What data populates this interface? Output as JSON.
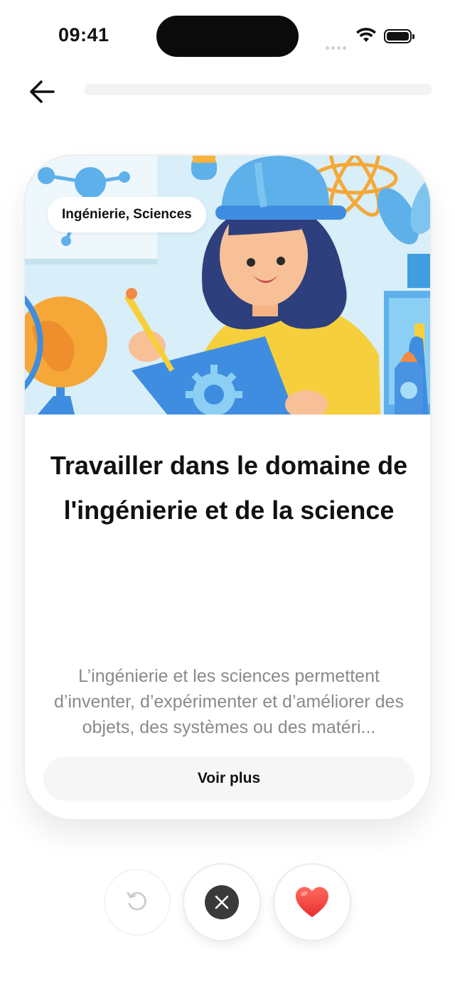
{
  "status_bar": {
    "time": "09:41"
  },
  "header": {
    "back_icon": "arrow-left-icon",
    "progress": 0.0
  },
  "card": {
    "tag": "Ingénierie, Sciences",
    "title": "Travailler dans le domaine de l'ingénierie et de la science",
    "description": "L’ingénierie et les sciences permettent d’inventer, d’expérimenter et d’améliorer des objets, des systèmes ou des matéri...",
    "more_label": "Voir plus",
    "illustration_icon": "engineer-illustration"
  },
  "actions": {
    "undo_icon": "undo-icon",
    "dislike_icon": "close-icon",
    "like_icon": "heart-icon"
  },
  "colors": {
    "like": "#f0433f",
    "dislike": "#3a3a3a",
    "illustration_bg": "#d8eef8"
  }
}
